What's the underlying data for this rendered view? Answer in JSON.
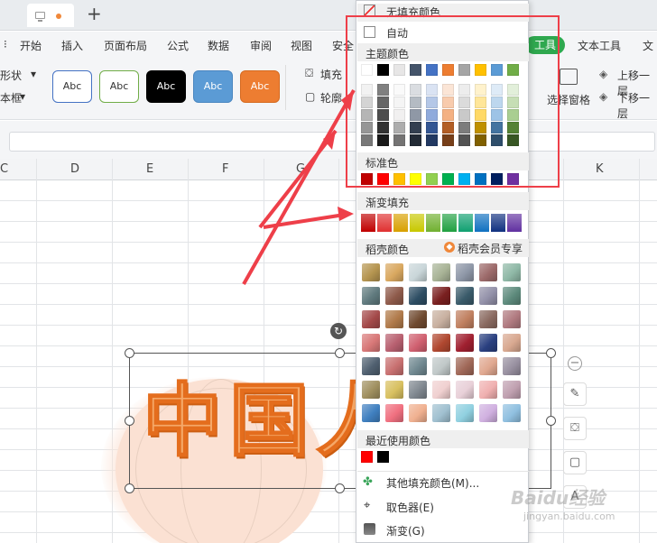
{
  "ribbon": {
    "menu": [
      "开始",
      "插入",
      "页面布局",
      "公式",
      "数据",
      "审阅",
      "视图",
      "安全"
    ],
    "menu_right": [
      "工具",
      "文本工具",
      "文"
    ],
    "left_stub": [
      "形状",
      "本框"
    ],
    "style_label": "Abc",
    "fill_label": "填充",
    "outline_label": "轮廓",
    "selection_pane": "选择窗格",
    "bring_forward": "上移一层",
    "send_backward": "下移一层"
  },
  "sheet": {
    "columns": [
      "C",
      "D",
      "E",
      "F",
      "G",
      "K"
    ]
  },
  "art": {
    "text": "中国人"
  },
  "fill_menu": {
    "no_fill": "无填充颜色",
    "auto": "自动",
    "theme_colors": "主题颜色",
    "standard_colors": "标准色",
    "gradient_fill": "渐变填充",
    "docer_colors": "稻壳颜色",
    "docer_vip": "稻壳会员专享",
    "recent_colors": "最近使用颜色",
    "more_colors": "其他填充颜色(M)...",
    "eyedropper": "取色器(E)",
    "gradient": "渐变(G)"
  },
  "colors": {
    "theme_top": [
      "#ffffff",
      "#000000",
      "#e7e6e6",
      "#44546a",
      "#4472c4",
      "#ed7d31",
      "#a5a5a5",
      "#ffc000",
      "#5b9bd5",
      "#70ad47"
    ],
    "standard": [
      "#c00000",
      "#ff0000",
      "#ffc000",
      "#ffff00",
      "#92d050",
      "#00b050",
      "#00b0f0",
      "#0070c0",
      "#002060",
      "#7030a0"
    ],
    "gradient": [
      "#c00000",
      "#e03030",
      "#d8a000",
      "#c8c800",
      "#70b030",
      "#20a040",
      "#10a070",
      "#1070c0",
      "#103080",
      "#6030a0"
    ],
    "recent": [
      "#ff0000",
      "#000000"
    ],
    "accent_red": "#ee3f49"
  },
  "watermark": {
    "brand": "Baidu经验",
    "url": "jingyan.baidu.com"
  }
}
